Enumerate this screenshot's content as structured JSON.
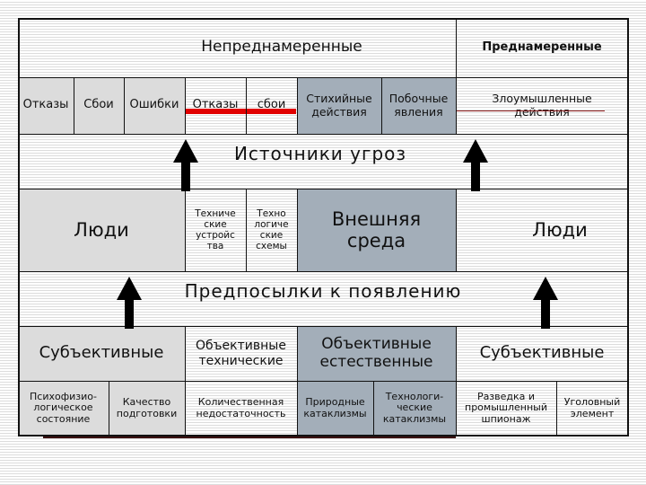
{
  "header": {
    "unintentional": "Непреднамеренные",
    "intentional": "Преднамеренные"
  },
  "row2": {
    "items": [
      {
        "label": "Отказы"
      },
      {
        "label": "Сбои"
      },
      {
        "label": "Ошибки"
      },
      {
        "label": "Отказы"
      },
      {
        "label": "сбои"
      },
      {
        "label": "Стихийные действия"
      },
      {
        "label": "Побочные явления"
      },
      {
        "label": "Злоумышленные действия"
      }
    ]
  },
  "sources_label": "Источники угроз",
  "row4": {
    "people_left": "Люди",
    "tech_devices": "Техниче ские устройс тва",
    "tech_schemes": "Техно логиче ские схемы",
    "environment": "Внешняя среда",
    "people_right": "Люди"
  },
  "preconditions_label": "Предпосылки к появлению",
  "row6": {
    "subjective_left": "Субъективные",
    "objective_tech": "Объективные технические",
    "objective_natural": "Объективные естественные",
    "subjective_right": "Субъективные"
  },
  "row7": {
    "items": [
      {
        "label": "Психофизио- логическое состояние"
      },
      {
        "label": "Качество подготовки"
      },
      {
        "label": "Количественная недостаточность"
      },
      {
        "label": "Природные катаклизмы"
      },
      {
        "label": "Технологи- ческие катаклизмы"
      },
      {
        "label": "Разведка и промышленный шпионаж"
      },
      {
        "label": "Уголовный элемент"
      }
    ]
  },
  "colors": {
    "human_fill": "#dcdcdc",
    "environment_fill": "#a3aeb9",
    "strike_red": "#e10000",
    "border": "#111111"
  }
}
